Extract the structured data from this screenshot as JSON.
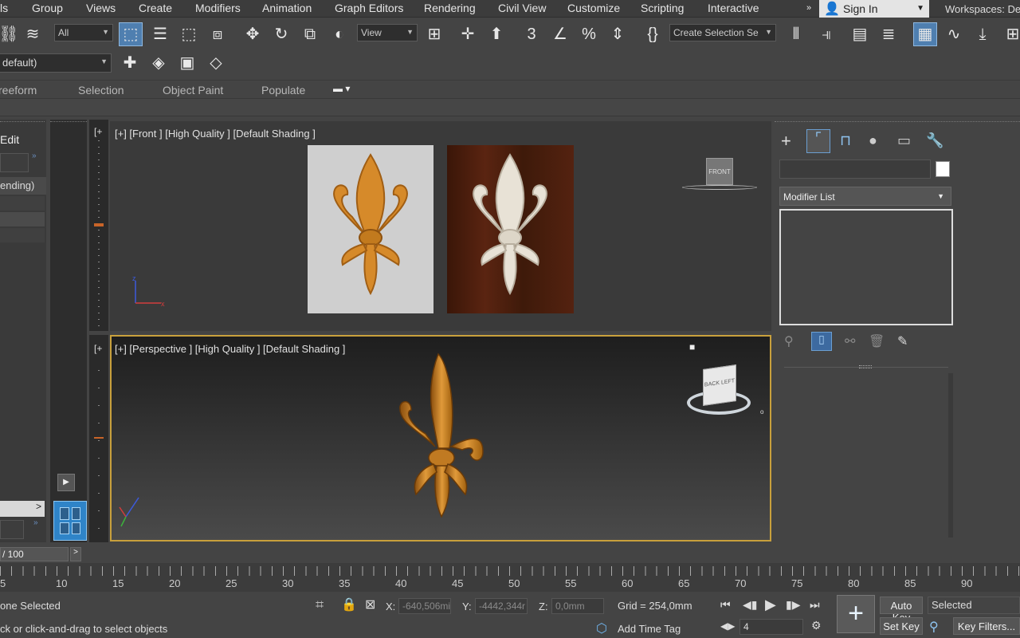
{
  "menu": {
    "items": [
      "ls",
      "Group",
      "Views",
      "Create",
      "Modifiers",
      "Animation",
      "Graph Editors",
      "Rendering",
      "Civil View",
      "Customize",
      "Scripting",
      "Interactive"
    ],
    "sign_in": "Sign In",
    "workspaces": "Workspaces: De"
  },
  "toolbar": {
    "filter_value": "All",
    "ref_coord_value": "View",
    "selection_set_placeholder": "Create Selection Se",
    "layer_value": "default)"
  },
  "ribbon": {
    "tabs": [
      "reeform",
      "Selection",
      "Object Paint",
      "Populate"
    ]
  },
  "scene_explorer": {
    "edit_label": "Edit",
    "sort_label": "ending)"
  },
  "viewports": {
    "front_label": "[+] [Front ] [High Quality ] [Default Shading ]",
    "perspective_label": "[+] [Perspective ] [High Quality ] [Default Shading ]",
    "viewcube_front": "FRONT",
    "viewcube_back": "BACK",
    "viewcube_left": "LEFT"
  },
  "command_panel": {
    "modifier_list": "Modifier List"
  },
  "timeline": {
    "frame_indicator": "/ 100",
    "ticks": [
      "5",
      "10",
      "15",
      "20",
      "25",
      "30",
      "35",
      "40",
      "45",
      "50",
      "55",
      "60",
      "65",
      "70",
      "75",
      "80",
      "85",
      "90"
    ]
  },
  "status": {
    "selection_text": "one Selected",
    "prompt_text": "ck or click-and-drag to select objects",
    "x_value": "-640,506mi",
    "y_value": "-4442,344r",
    "z_value": "0,0mm",
    "x_label": "X:",
    "y_label": "Y:",
    "z_label": "Z:",
    "grid": "Grid = 254,0mm",
    "add_time_tag": "Add Time Tag",
    "current_frame": "4",
    "auto_key": "Auto Key",
    "set_key": "Set Key",
    "key_mode": "Selected",
    "key_filters": "Key Filters..."
  },
  "colors": {
    "accent": "#c8a03c",
    "selected_button": "#4f7fb0",
    "fleur_orange": "#d68a2a"
  }
}
